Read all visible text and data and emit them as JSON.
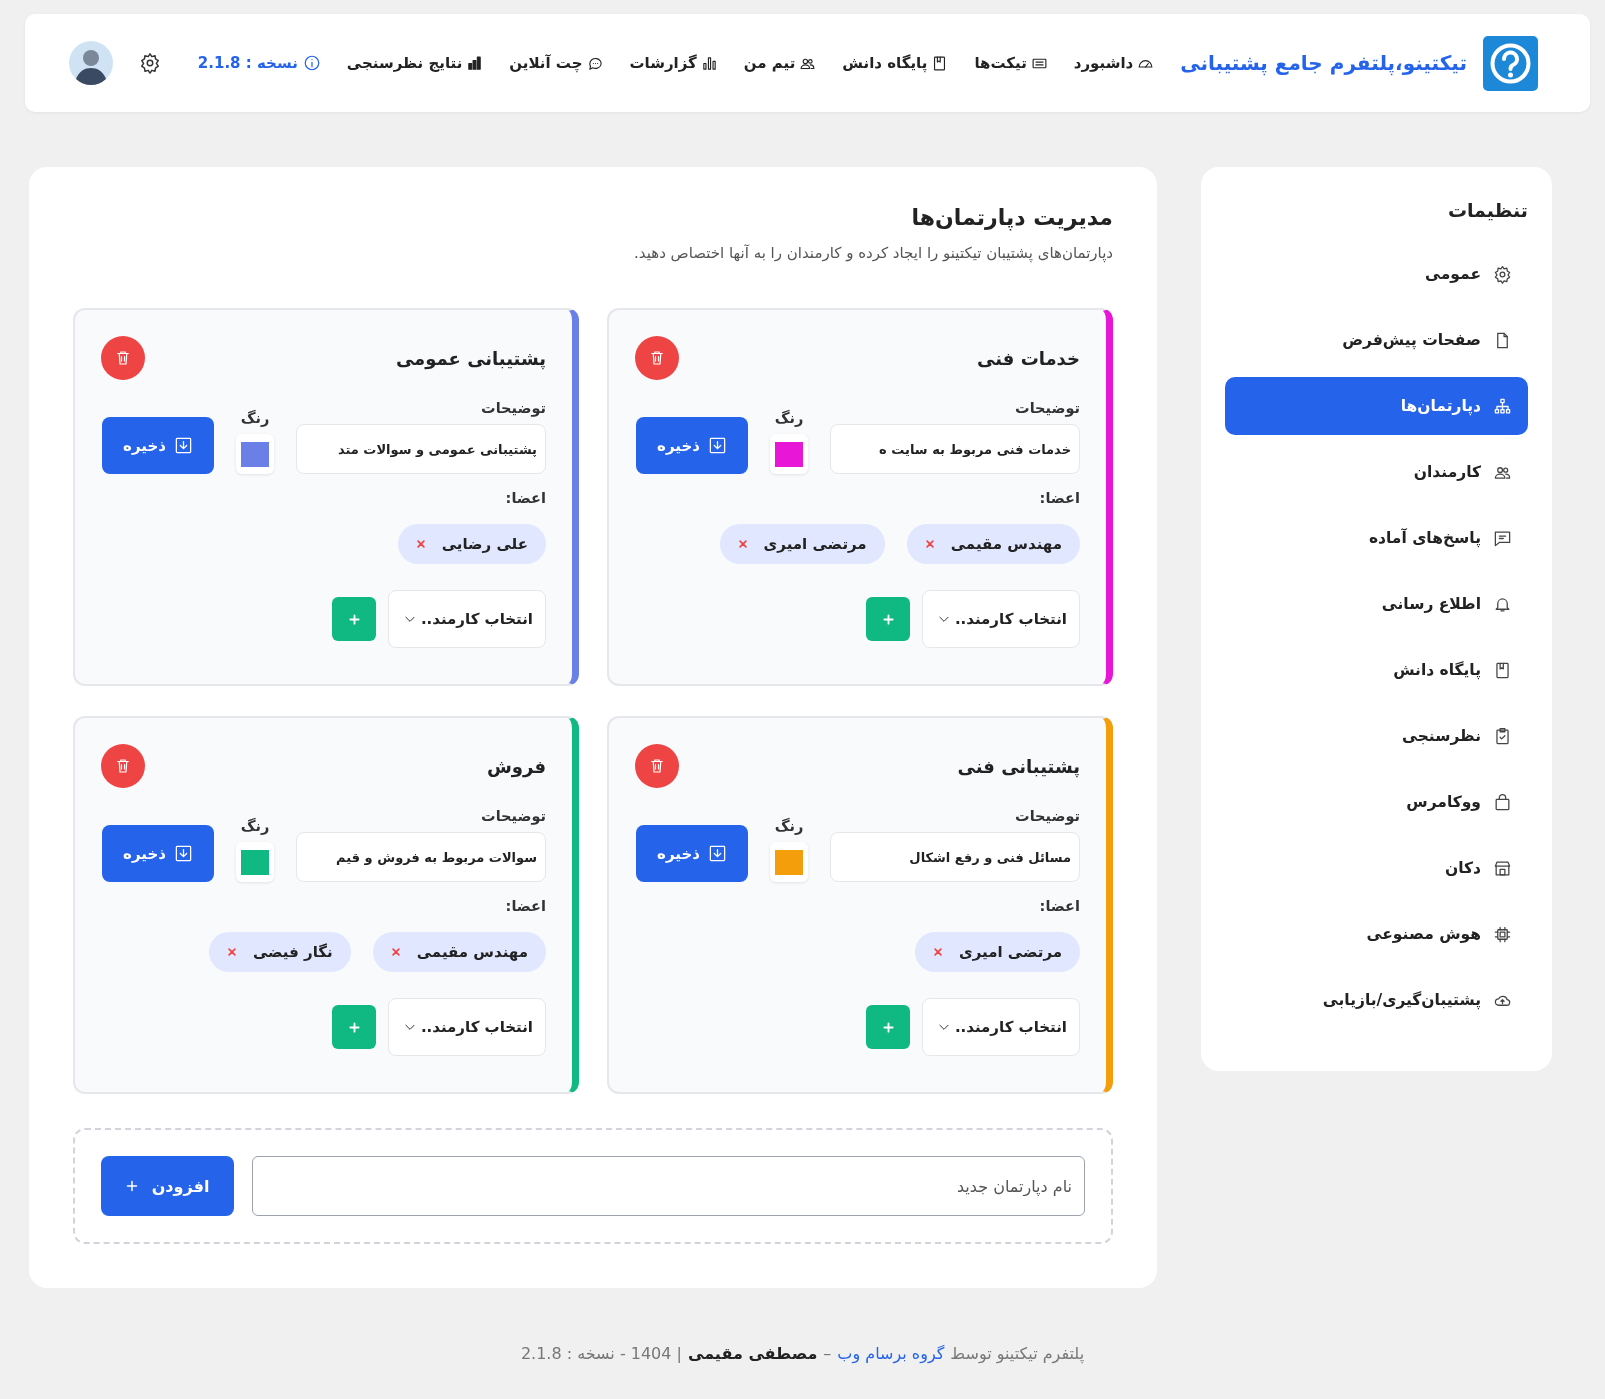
{
  "header": {
    "title": "تیکتینو،پلتفرم جامع پشتیبانی",
    "nav": [
      {
        "label": "داشبورد"
      },
      {
        "label": "تیکت‌ها"
      },
      {
        "label": "پایگاه دانش"
      },
      {
        "label": "تیم من"
      },
      {
        "label": "گزارشات"
      },
      {
        "label": "چت آنلاین"
      },
      {
        "label": "نتایج نظرسنجی"
      }
    ],
    "version": "نسخه : 2.1.8"
  },
  "sidebar": {
    "title": "تنظیمات",
    "items": [
      {
        "label": "عمومی",
        "selected": false
      },
      {
        "label": "صفحات پیش‌فرض",
        "selected": false
      },
      {
        "label": "دپارتمان‌ها",
        "selected": true
      },
      {
        "label": "کارمندان",
        "selected": false
      },
      {
        "label": "پاسخ‌های آماده",
        "selected": false
      },
      {
        "label": "اطلاع رسانی",
        "selected": false
      },
      {
        "label": "پایگاه دانش",
        "selected": false
      },
      {
        "label": "نظرسنجی",
        "selected": false
      },
      {
        "label": "ووکامرس",
        "selected": false
      },
      {
        "label": "دکان",
        "selected": false
      },
      {
        "label": "هوش مصنوعی",
        "selected": false
      },
      {
        "label": "پشتیبان‌گیری/بازیابی",
        "selected": false
      }
    ]
  },
  "page": {
    "title": "مدیریت دپارتمان‌ها",
    "subtitle": "دپارتمان‌های پشتیبان تیکتینو را ایجاد کرده و کارمندان را به آنها اختصاص دهید."
  },
  "departments": [
    {
      "name": "خدمات فنی",
      "color": "#e816d6",
      "description_label": "توضیحات",
      "description": "خدمات فنی مربوط به سایت ه",
      "color_label": "رنگ",
      "save": "ذخیره",
      "members_label": "اعضا:",
      "members": [
        "مهندس مقیمی",
        "مرتضی امیری"
      ],
      "select_placeholder": "انتخاب کارمند.."
    },
    {
      "name": "پشتیبانی عمومی",
      "color": "#6b80e6",
      "description_label": "توضیحات",
      "description": "پشتیبانی عمومی و سوالات متد",
      "color_label": "رنگ",
      "save": "ذخیره",
      "members_label": "اعضا:",
      "members": [
        "علی رضایی"
      ],
      "select_placeholder": "انتخاب کارمند.."
    },
    {
      "name": "پشتیبانی فنی",
      "color": "#f59e0b",
      "description_label": "توضیحات",
      "description": "مسائل فنی و رفع اشکال",
      "color_label": "رنگ",
      "save": "ذخیره",
      "members_label": "اعضا:",
      "members": [
        "مرتضی امیری"
      ],
      "select_placeholder": "انتخاب کارمند.."
    },
    {
      "name": "فروش",
      "color": "#10b981",
      "description_label": "توضیحات",
      "description": "سوالات مربوط به فروش و قیم",
      "color_label": "رنگ",
      "save": "ذخیره",
      "members_label": "اعضا:",
      "members": [
        "مهندس مقیمی",
        "نگار فیضی"
      ],
      "select_placeholder": "انتخاب کارمند.."
    }
  ],
  "add_form": {
    "placeholder": "نام دپارتمان جدید",
    "button": "افزودن"
  },
  "footer": {
    "prefix": "پلتفرم تیکتینو توسط",
    "link": "گروه برسام وب",
    "dash": "–",
    "author": "مصطفی مقیمی",
    "suffix": "| 1404 - نسخه : 2.1.8"
  }
}
